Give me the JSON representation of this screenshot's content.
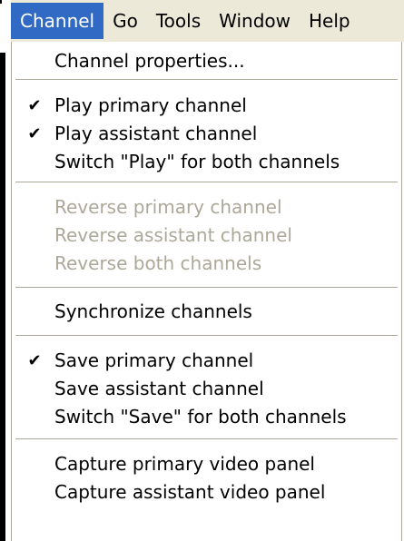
{
  "menubar": {
    "items": [
      {
        "label": "Channel"
      },
      {
        "label": "Go"
      },
      {
        "label": "Tools"
      },
      {
        "label": "Window"
      },
      {
        "label": "Help"
      }
    ]
  },
  "menu": {
    "channel_properties": "Channel properties...",
    "play_primary": "Play primary channel",
    "play_assistant": "Play assistant channel",
    "switch_play": "Switch \"Play\" for both channels",
    "reverse_primary": "Reverse primary channel",
    "reverse_assistant": "Reverse assistant channel",
    "reverse_both": "Reverse both channels",
    "synchronize": "Synchronize channels",
    "save_primary": "Save primary channel",
    "save_assistant": "Save assistant channel",
    "switch_save": "Switch \"Save\" for both channels",
    "capture_primary": "Capture primary video panel",
    "capture_assistant": "Capture assistant video panel"
  },
  "glyphs": {
    "check": "✔"
  },
  "colors": {
    "menubar_bg": "#ece9d8",
    "highlight": "#316ac5",
    "disabled_text": "#aca899",
    "separator": "#aca899"
  }
}
